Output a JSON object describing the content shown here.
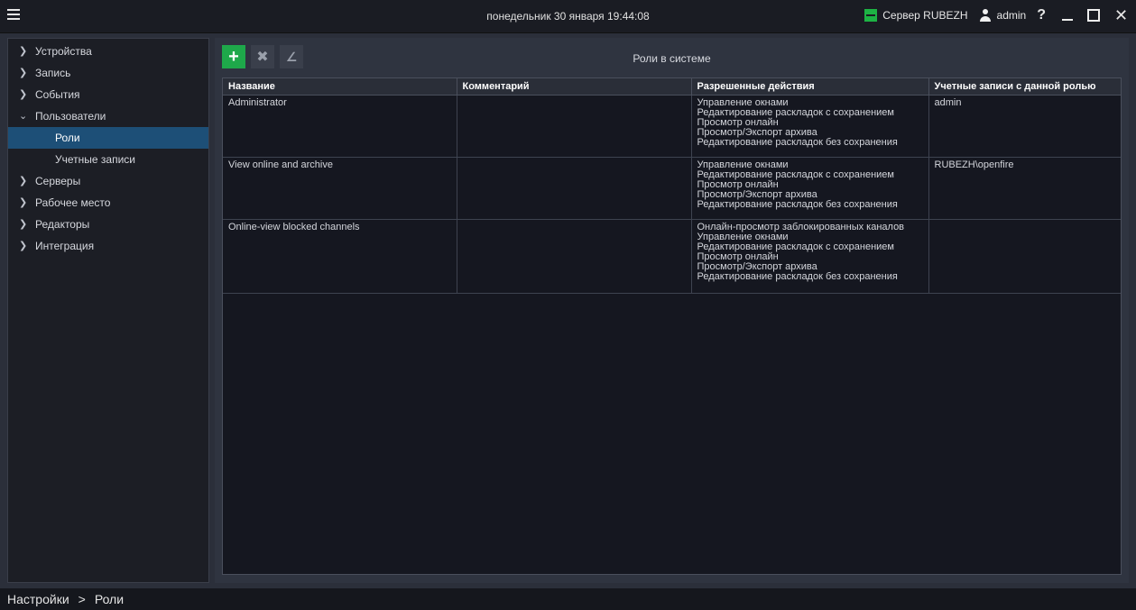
{
  "titlebar": {
    "datetime": "понедельник 30 января 19:44:08",
    "server_label": "Сервер RUBEZH",
    "user_label": "admin",
    "help_symbol": "?",
    "close_symbol": "✕"
  },
  "sidebar": {
    "items": [
      {
        "label": "Устройства",
        "chevron": "❯"
      },
      {
        "label": "Запись",
        "chevron": "❯"
      },
      {
        "label": "События",
        "chevron": "❯"
      },
      {
        "label": "Пользователи",
        "chevron": "⌄"
      },
      {
        "label": "Роли"
      },
      {
        "label": "Учетные записи"
      },
      {
        "label": "Серверы",
        "chevron": "❯"
      },
      {
        "label": "Рабочее место",
        "chevron": "❯"
      },
      {
        "label": "Редакторы",
        "chevron": "❯"
      },
      {
        "label": "Интеграция",
        "chevron": "❯"
      }
    ]
  },
  "toolbar": {
    "add_icon": "+",
    "delete_icon": "✖",
    "edit_icon": "∠"
  },
  "panel": {
    "title": "Роли в системе"
  },
  "table": {
    "headers": [
      "Название",
      "Комментарий",
      "Разрешенные действия",
      "Учетные записи с данной ролью"
    ],
    "rows": [
      {
        "name": "Administrator",
        "comment": "",
        "actions": [
          "Управление окнами",
          "Редактирование раскладок с сохранением",
          "Просмотр онлайн",
          "Просмотр/Экспорт архива",
          "Редактирование раскладок без сохранения"
        ],
        "accounts": "admin"
      },
      {
        "name": "View online and archive",
        "comment": "",
        "actions": [
          "Управление окнами",
          "Редактирование раскладок с сохранением",
          "Просмотр онлайн",
          "Просмотр/Экспорт архива",
          "Редактирование раскладок без сохранения"
        ],
        "accounts": "RUBEZH\\openfire"
      },
      {
        "name": "Online-view blocked channels",
        "comment": "",
        "actions": [
          "Онлайн-просмотр заблокированных каналов",
          "Управление окнами",
          "Редактирование раскладок с сохранением",
          "Просмотр онлайн",
          "Просмотр/Экспорт архива",
          "Редактирование раскладок без сохранения"
        ],
        "accounts": ""
      }
    ]
  },
  "statusbar": {
    "breadcrumb_root": "Настройки",
    "separator": ">",
    "breadcrumb_current": "Роли"
  }
}
